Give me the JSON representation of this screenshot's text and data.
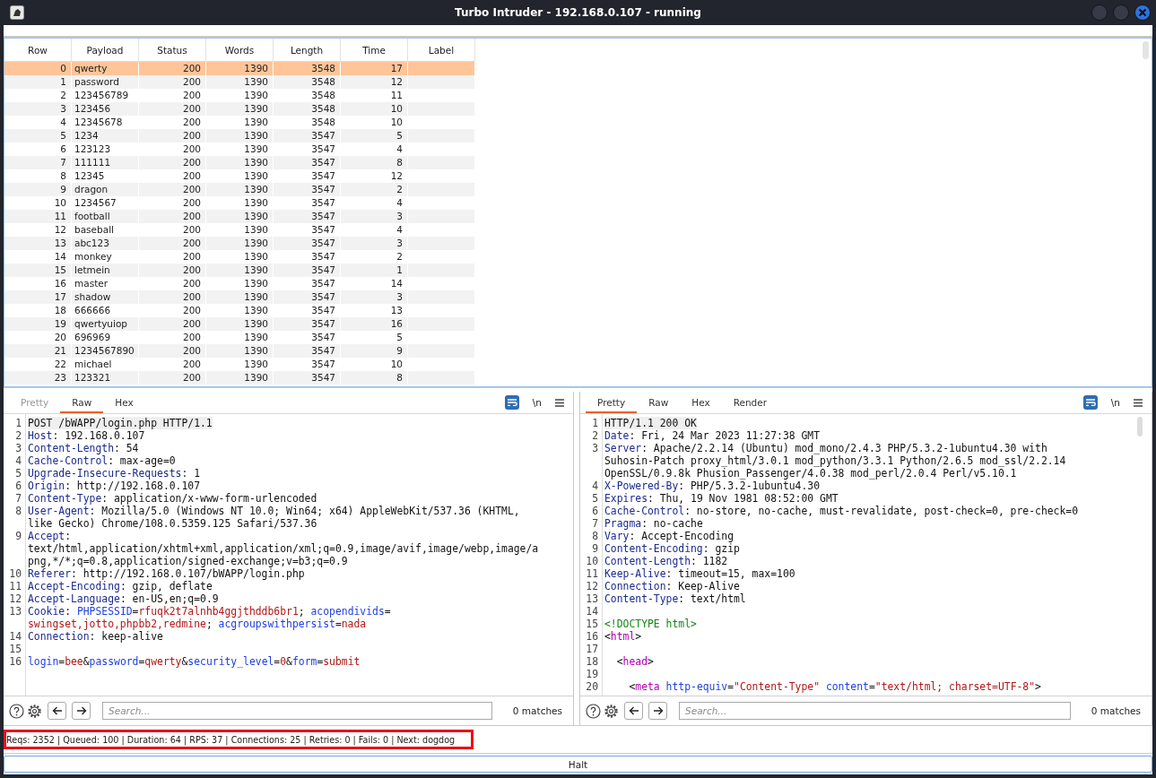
{
  "window": {
    "title": "Turbo Intruder - 192.168.0.107 - running"
  },
  "table": {
    "columns": [
      "Row",
      "Payload",
      "Status",
      "Words",
      "Length",
      "Time",
      "Label"
    ],
    "rows": [
      {
        "cells": [
          "0",
          "qwerty",
          "200",
          "1390",
          "3548",
          "17"
        ],
        "selected": true
      },
      {
        "cells": [
          "1",
          "password",
          "200",
          "1390",
          "3548",
          "12"
        ],
        "selected": false
      },
      {
        "cells": [
          "2",
          "123456789",
          "200",
          "1390",
          "3548",
          "11"
        ],
        "selected": false
      },
      {
        "cells": [
          "3",
          "123456",
          "200",
          "1390",
          "3548",
          "10"
        ],
        "selected": false
      },
      {
        "cells": [
          "4",
          "12345678",
          "200",
          "1390",
          "3548",
          "10"
        ],
        "selected": false
      },
      {
        "cells": [
          "5",
          "1234",
          "200",
          "1390",
          "3547",
          "5"
        ],
        "selected": false
      },
      {
        "cells": [
          "6",
          "123123",
          "200",
          "1390",
          "3547",
          "4"
        ],
        "selected": false
      },
      {
        "cells": [
          "7",
          "111111",
          "200",
          "1390",
          "3547",
          "8"
        ],
        "selected": false
      },
      {
        "cells": [
          "8",
          "12345",
          "200",
          "1390",
          "3547",
          "12"
        ],
        "selected": false
      },
      {
        "cells": [
          "9",
          "dragon",
          "200",
          "1390",
          "3547",
          "2"
        ],
        "selected": false
      },
      {
        "cells": [
          "10",
          "1234567",
          "200",
          "1390",
          "3547",
          "4"
        ],
        "selected": false
      },
      {
        "cells": [
          "11",
          "football",
          "200",
          "1390",
          "3547",
          "3"
        ],
        "selected": false
      },
      {
        "cells": [
          "12",
          "baseball",
          "200",
          "1390",
          "3547",
          "4"
        ],
        "selected": false
      },
      {
        "cells": [
          "13",
          "abc123",
          "200",
          "1390",
          "3547",
          "3"
        ],
        "selected": false
      },
      {
        "cells": [
          "14",
          "monkey",
          "200",
          "1390",
          "3547",
          "2"
        ],
        "selected": false
      },
      {
        "cells": [
          "15",
          "letmein",
          "200",
          "1390",
          "3547",
          "1"
        ],
        "selected": false
      },
      {
        "cells": [
          "16",
          "master",
          "200",
          "1390",
          "3547",
          "14"
        ],
        "selected": false
      },
      {
        "cells": [
          "17",
          "shadow",
          "200",
          "1390",
          "3547",
          "3"
        ],
        "selected": false
      },
      {
        "cells": [
          "18",
          "666666",
          "200",
          "1390",
          "3547",
          "13"
        ],
        "selected": false
      },
      {
        "cells": [
          "19",
          "qwertyuiop",
          "200",
          "1390",
          "3547",
          "16"
        ],
        "selected": false
      },
      {
        "cells": [
          "20",
          "696969",
          "200",
          "1390",
          "3547",
          "5"
        ],
        "selected": false
      },
      {
        "cells": [
          "21",
          "1234567890",
          "200",
          "1390",
          "3547",
          "9"
        ],
        "selected": false
      },
      {
        "cells": [
          "22",
          "michael",
          "200",
          "1390",
          "3547",
          "10"
        ],
        "selected": false
      },
      {
        "cells": [
          "23",
          "123321",
          "200",
          "1390",
          "3547",
          "8"
        ],
        "selected": false
      }
    ]
  },
  "panes": [
    {
      "tabs": [
        {
          "label": "Pretty",
          "selected": false,
          "disabled": true
        },
        {
          "label": "Raw",
          "selected": true,
          "disabled": false
        },
        {
          "label": "Hex",
          "selected": false,
          "disabled": false
        }
      ],
      "newline_toggle": "\\n",
      "lines": [
        {
          "num": "1",
          "parts": [
            {
              "kind": "plain",
              "text": "POST /bWAPP/login.php HTTP/1.1"
            }
          ]
        },
        {
          "num": "2",
          "parts": [
            {
              "kind": "header",
              "text": "Host"
            },
            {
              "kind": "plain",
              "text": ": 192.168.0.107"
            }
          ]
        },
        {
          "num": "3",
          "parts": [
            {
              "kind": "header",
              "text": "Content-Length"
            },
            {
              "kind": "plain",
              "text": ": 54"
            }
          ]
        },
        {
          "num": "4",
          "parts": [
            {
              "kind": "header",
              "text": "Cache-Control"
            },
            {
              "kind": "plain",
              "text": ": max-age=0"
            }
          ]
        },
        {
          "num": "5",
          "parts": [
            {
              "kind": "header",
              "text": "Upgrade-Insecure-Requests"
            },
            {
              "kind": "plain",
              "text": ": 1"
            }
          ]
        },
        {
          "num": "6",
          "parts": [
            {
              "kind": "header",
              "text": "Origin"
            },
            {
              "kind": "plain",
              "text": ": http://192.168.0.107"
            }
          ]
        },
        {
          "num": "7",
          "parts": [
            {
              "kind": "header",
              "text": "Content-Type"
            },
            {
              "kind": "plain",
              "text": ": application/x-www-form-urlencoded"
            }
          ]
        },
        {
          "num": "8",
          "parts": [
            {
              "kind": "header",
              "text": "User-Agent"
            },
            {
              "kind": "plain",
              "text": ": Mozilla/5.0 (Windows NT 10.0; Win64; x64) AppleWebKit/537.36 (KHTML,"
            }
          ]
        },
        {
          "parts": [
            {
              "kind": "plain",
              "text": "like Gecko) Chrome/108.0.5359.125 Safari/537.36"
            }
          ]
        },
        {
          "num": "9",
          "parts": [
            {
              "kind": "header",
              "text": "Accept"
            },
            {
              "kind": "plain",
              "text": ":"
            }
          ]
        },
        {
          "parts": [
            {
              "kind": "plain",
              "text": "text/html,application/xhtml+xml,application/xml;q=0.9,image/avif,image/webp,image/a"
            }
          ]
        },
        {
          "parts": [
            {
              "kind": "plain",
              "text": "png,*/*;q=0.8,application/signed-exchange;v=b3;q=0.9"
            }
          ]
        },
        {
          "num": "10",
          "parts": [
            {
              "kind": "header",
              "text": "Referer"
            },
            {
              "kind": "plain",
              "text": ": http://192.168.0.107/bWAPP/login.php"
            }
          ]
        },
        {
          "num": "11",
          "parts": [
            {
              "kind": "header",
              "text": "Accept-Encoding"
            },
            {
              "kind": "plain",
              "text": ": gzip, deflate"
            }
          ]
        },
        {
          "num": "12",
          "parts": [
            {
              "kind": "header",
              "text": "Accept-Language"
            },
            {
              "kind": "plain",
              "text": ": en-US,en;q=0.9"
            }
          ]
        },
        {
          "num": "13",
          "parts": [
            {
              "kind": "header",
              "text": "Cookie"
            },
            {
              "kind": "plain",
              "text": ": "
            },
            {
              "kind": "name",
              "text": "PHPSESSID"
            },
            {
              "kind": "plain",
              "text": "="
            },
            {
              "kind": "value",
              "text": "rfuqk2t7alnhb4ggjthddb6br1"
            },
            {
              "kind": "plain",
              "text": "; "
            },
            {
              "kind": "name",
              "text": "acopendivids"
            },
            {
              "kind": "plain",
              "text": "="
            }
          ]
        },
        {
          "parts": [
            {
              "kind": "value",
              "text": "swingset,jotto,phpbb2,redmine"
            },
            {
              "kind": "plain",
              "text": "; "
            },
            {
              "kind": "name",
              "text": "acgroupswithpersist"
            },
            {
              "kind": "plain",
              "text": "="
            },
            {
              "kind": "value",
              "text": "nada"
            }
          ]
        },
        {
          "num": "14",
          "parts": [
            {
              "kind": "header",
              "text": "Connection"
            },
            {
              "kind": "plain",
              "text": ": keep-alive"
            }
          ]
        },
        {
          "num": "15"
        },
        {
          "num": "16",
          "parts": [
            {
              "kind": "name",
              "text": "login"
            },
            {
              "kind": "plain",
              "text": "="
            },
            {
              "kind": "value",
              "text": "bee"
            },
            {
              "kind": "plain",
              "text": "&"
            },
            {
              "kind": "name",
              "text": "password"
            },
            {
              "kind": "plain",
              "text": "="
            },
            {
              "kind": "value",
              "text": "qwerty"
            },
            {
              "kind": "plain",
              "text": "&"
            },
            {
              "kind": "name",
              "text": "security_level"
            },
            {
              "kind": "plain",
              "text": "="
            },
            {
              "kind": "value",
              "text": "0"
            },
            {
              "kind": "plain",
              "text": "&"
            },
            {
              "kind": "name",
              "text": "form"
            },
            {
              "kind": "plain",
              "text": "="
            },
            {
              "kind": "value",
              "text": "submit"
            }
          ]
        }
      ],
      "search": {
        "placeholder": "Search..."
      },
      "matches": "0 matches"
    },
    {
      "tabs": [
        {
          "label": "Pretty",
          "selected": true,
          "disabled": false
        },
        {
          "label": "Raw",
          "selected": false,
          "disabled": false
        },
        {
          "label": "Hex",
          "selected": false,
          "disabled": false
        },
        {
          "label": "Render",
          "selected": false,
          "disabled": false
        }
      ],
      "newline_toggle": "\\n",
      "lines": [
        {
          "num": "1",
          "parts": [
            {
              "kind": "plain",
              "text": "HTTP/1.1 200 OK"
            }
          ]
        },
        {
          "num": "2",
          "parts": [
            {
              "kind": "header",
              "text": "Date"
            },
            {
              "kind": "plain",
              "text": ": Fri, 24 Mar 2023 11:27:38 GMT"
            }
          ]
        },
        {
          "num": "3",
          "parts": [
            {
              "kind": "header",
              "text": "Server"
            },
            {
              "kind": "plain",
              "text": ": Apache/2.2.14 (Ubuntu) mod_mono/2.4.3 PHP/5.3.2-1ubuntu4.30 with"
            }
          ]
        },
        {
          "parts": [
            {
              "kind": "plain",
              "text": "Suhosin-Patch proxy_html/3.0.1 mod_python/3.3.1 Python/2.6.5 mod_ssl/2.2.14"
            }
          ]
        },
        {
          "parts": [
            {
              "kind": "plain",
              "text": "OpenSSL/0.9.8k Phusion_Passenger/4.0.38 mod_perl/2.0.4 Perl/v5.10.1"
            }
          ]
        },
        {
          "num": "4",
          "parts": [
            {
              "kind": "header",
              "text": "X-Powered-By"
            },
            {
              "kind": "plain",
              "text": ": PHP/5.3.2-1ubuntu4.30"
            }
          ]
        },
        {
          "num": "5",
          "parts": [
            {
              "kind": "header",
              "text": "Expires"
            },
            {
              "kind": "plain",
              "text": ": Thu, 19 Nov 1981 08:52:00 GMT"
            }
          ]
        },
        {
          "num": "6",
          "parts": [
            {
              "kind": "header",
              "text": "Cache-Control"
            },
            {
              "kind": "plain",
              "text": ": no-store, no-cache, must-revalidate, post-check=0, pre-check=0"
            }
          ]
        },
        {
          "num": "7",
          "parts": [
            {
              "kind": "header",
              "text": "Pragma"
            },
            {
              "kind": "plain",
              "text": ": no-cache"
            }
          ]
        },
        {
          "num": "8",
          "parts": [
            {
              "kind": "header",
              "text": "Vary"
            },
            {
              "kind": "plain",
              "text": ": Accept-Encoding"
            }
          ]
        },
        {
          "num": "9",
          "parts": [
            {
              "kind": "header",
              "text": "Content-Encoding"
            },
            {
              "kind": "plain",
              "text": ": gzip"
            }
          ]
        },
        {
          "num": "10",
          "parts": [
            {
              "kind": "header",
              "text": "Content-Length"
            },
            {
              "kind": "plain",
              "text": ": 1182"
            }
          ]
        },
        {
          "num": "11",
          "parts": [
            {
              "kind": "header",
              "text": "Keep-Alive"
            },
            {
              "kind": "plain",
              "text": ": timeout=15, max=100"
            }
          ]
        },
        {
          "num": "12",
          "parts": [
            {
              "kind": "header",
              "text": "Connection"
            },
            {
              "kind": "plain",
              "text": ": Keep-Alive"
            }
          ]
        },
        {
          "num": "13",
          "parts": [
            {
              "kind": "header",
              "text": "Content-Type"
            },
            {
              "kind": "plain",
              "text": ": text/html"
            }
          ]
        },
        {
          "num": "14"
        },
        {
          "num": "15",
          "parts": [
            {
              "kind": "doctype",
              "text": "<!DOCTYPE html>"
            }
          ]
        },
        {
          "num": "16",
          "parts": [
            {
              "kind": "plain",
              "text": "<"
            },
            {
              "kind": "tag",
              "text": "html"
            },
            {
              "kind": "plain",
              "text": ">"
            }
          ]
        },
        {
          "num": "17"
        },
        {
          "num": "18",
          "parts": [
            {
              "kind": "plain",
              "text": "  <"
            },
            {
              "kind": "tag",
              "text": "head"
            },
            {
              "kind": "plain",
              "text": ">"
            }
          ]
        },
        {
          "num": "19"
        },
        {
          "num": "20",
          "parts": [
            {
              "kind": "plain",
              "text": "    <"
            },
            {
              "kind": "tag",
              "text": "meta"
            },
            {
              "kind": "name",
              "text": " http-equiv"
            },
            {
              "kind": "plain",
              "text": "="
            },
            {
              "kind": "value",
              "text": "\"Content-Type\""
            },
            {
              "kind": "name",
              "text": " content"
            },
            {
              "kind": "plain",
              "text": "="
            },
            {
              "kind": "value",
              "text": "\"text/html; charset=UTF-8\""
            },
            {
              "kind": "plain",
              "text": ">"
            }
          ]
        }
      ],
      "search": {
        "placeholder": "Search..."
      },
      "matches": "0 matches"
    }
  ],
  "status_bar": {
    "text": "Reqs: 2352 | Queued: 100 | Duration: 64 | RPS: 37 | Connections: 25 | Retries: 0 | Fails: 0 | Next: dogdog"
  },
  "halt_button": {
    "label": "Halt"
  }
}
